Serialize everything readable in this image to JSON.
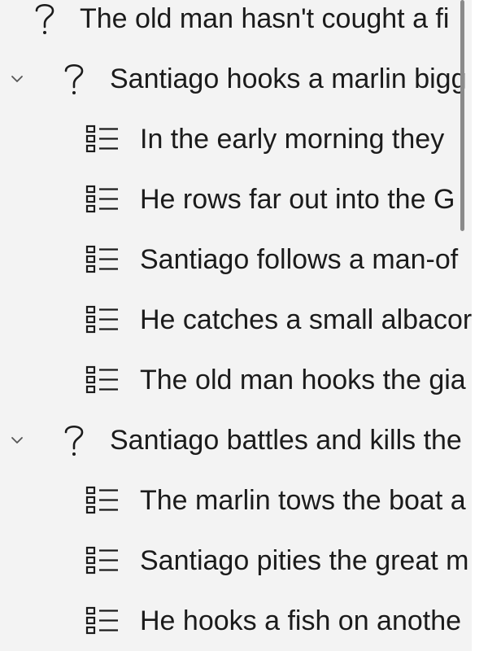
{
  "tree": {
    "items": [
      {
        "kind": "question",
        "icon": "question-icon",
        "label": "The old man hasn't cought a fi"
      },
      {
        "kind": "question",
        "icon": "question-icon",
        "chevron": "chevron-down-icon",
        "label": "Santiago hooks a marlin bigg"
      },
      {
        "kind": "detail",
        "icon": "list-icon",
        "label": "In the early morning they"
      },
      {
        "kind": "detail",
        "icon": "list-icon",
        "label": "He rows far out into the G"
      },
      {
        "kind": "detail",
        "icon": "list-icon",
        "label": "Santiago follows a man-of"
      },
      {
        "kind": "detail",
        "icon": "list-icon",
        "label": "He catches a small albacor"
      },
      {
        "kind": "detail",
        "icon": "list-icon",
        "label": "The old man hooks the gia"
      },
      {
        "kind": "question",
        "icon": "question-icon",
        "chevron": "chevron-down-icon",
        "label": "Santiago battles and kills the"
      },
      {
        "kind": "detail",
        "icon": "list-icon",
        "label": "The marlin tows the boat a"
      },
      {
        "kind": "detail",
        "icon": "list-icon",
        "label": "Santiago pities the great m"
      },
      {
        "kind": "detail",
        "icon": "list-icon",
        "label": "He hooks a fish on anothe"
      }
    ]
  },
  "colors": {
    "background": "#f3f3f3",
    "text": "#1b1b1b",
    "scrollbar": "#8a8a8a"
  }
}
